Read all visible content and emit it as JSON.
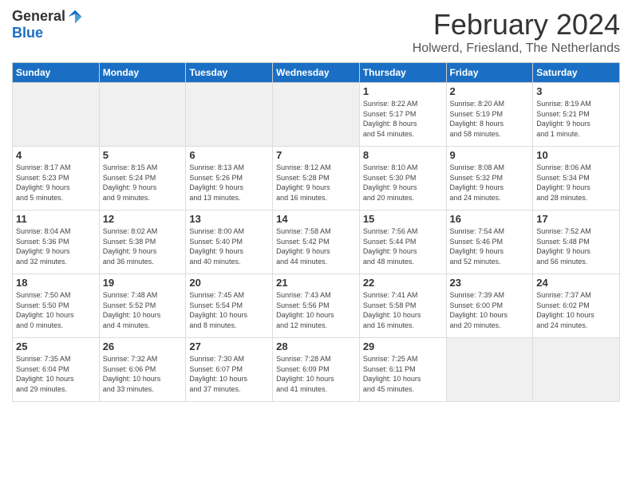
{
  "logo": {
    "general": "General",
    "blue": "Blue"
  },
  "title": "February 2024",
  "location": "Holwerd, Friesland, The Netherlands",
  "days_header": [
    "Sunday",
    "Monday",
    "Tuesday",
    "Wednesday",
    "Thursday",
    "Friday",
    "Saturday"
  ],
  "weeks": [
    [
      {
        "day": "",
        "empty": true
      },
      {
        "day": "",
        "empty": true
      },
      {
        "day": "",
        "empty": true
      },
      {
        "day": "",
        "empty": true
      },
      {
        "day": "1",
        "info": "Sunrise: 8:22 AM\nSunset: 5:17 PM\nDaylight: 8 hours\nand 54 minutes."
      },
      {
        "day": "2",
        "info": "Sunrise: 8:20 AM\nSunset: 5:19 PM\nDaylight: 8 hours\nand 58 minutes."
      },
      {
        "day": "3",
        "info": "Sunrise: 8:19 AM\nSunset: 5:21 PM\nDaylight: 9 hours\nand 1 minute."
      }
    ],
    [
      {
        "day": "4",
        "info": "Sunrise: 8:17 AM\nSunset: 5:23 PM\nDaylight: 9 hours\nand 5 minutes."
      },
      {
        "day": "5",
        "info": "Sunrise: 8:15 AM\nSunset: 5:24 PM\nDaylight: 9 hours\nand 9 minutes."
      },
      {
        "day": "6",
        "info": "Sunrise: 8:13 AM\nSunset: 5:26 PM\nDaylight: 9 hours\nand 13 minutes."
      },
      {
        "day": "7",
        "info": "Sunrise: 8:12 AM\nSunset: 5:28 PM\nDaylight: 9 hours\nand 16 minutes."
      },
      {
        "day": "8",
        "info": "Sunrise: 8:10 AM\nSunset: 5:30 PM\nDaylight: 9 hours\nand 20 minutes."
      },
      {
        "day": "9",
        "info": "Sunrise: 8:08 AM\nSunset: 5:32 PM\nDaylight: 9 hours\nand 24 minutes."
      },
      {
        "day": "10",
        "info": "Sunrise: 8:06 AM\nSunset: 5:34 PM\nDaylight: 9 hours\nand 28 minutes."
      }
    ],
    [
      {
        "day": "11",
        "info": "Sunrise: 8:04 AM\nSunset: 5:36 PM\nDaylight: 9 hours\nand 32 minutes."
      },
      {
        "day": "12",
        "info": "Sunrise: 8:02 AM\nSunset: 5:38 PM\nDaylight: 9 hours\nand 36 minutes."
      },
      {
        "day": "13",
        "info": "Sunrise: 8:00 AM\nSunset: 5:40 PM\nDaylight: 9 hours\nand 40 minutes."
      },
      {
        "day": "14",
        "info": "Sunrise: 7:58 AM\nSunset: 5:42 PM\nDaylight: 9 hours\nand 44 minutes."
      },
      {
        "day": "15",
        "info": "Sunrise: 7:56 AM\nSunset: 5:44 PM\nDaylight: 9 hours\nand 48 minutes."
      },
      {
        "day": "16",
        "info": "Sunrise: 7:54 AM\nSunset: 5:46 PM\nDaylight: 9 hours\nand 52 minutes."
      },
      {
        "day": "17",
        "info": "Sunrise: 7:52 AM\nSunset: 5:48 PM\nDaylight: 9 hours\nand 56 minutes."
      }
    ],
    [
      {
        "day": "18",
        "info": "Sunrise: 7:50 AM\nSunset: 5:50 PM\nDaylight: 10 hours\nand 0 minutes."
      },
      {
        "day": "19",
        "info": "Sunrise: 7:48 AM\nSunset: 5:52 PM\nDaylight: 10 hours\nand 4 minutes."
      },
      {
        "day": "20",
        "info": "Sunrise: 7:45 AM\nSunset: 5:54 PM\nDaylight: 10 hours\nand 8 minutes."
      },
      {
        "day": "21",
        "info": "Sunrise: 7:43 AM\nSunset: 5:56 PM\nDaylight: 10 hours\nand 12 minutes."
      },
      {
        "day": "22",
        "info": "Sunrise: 7:41 AM\nSunset: 5:58 PM\nDaylight: 10 hours\nand 16 minutes."
      },
      {
        "day": "23",
        "info": "Sunrise: 7:39 AM\nSunset: 6:00 PM\nDaylight: 10 hours\nand 20 minutes."
      },
      {
        "day": "24",
        "info": "Sunrise: 7:37 AM\nSunset: 6:02 PM\nDaylight: 10 hours\nand 24 minutes."
      }
    ],
    [
      {
        "day": "25",
        "info": "Sunrise: 7:35 AM\nSunset: 6:04 PM\nDaylight: 10 hours\nand 29 minutes."
      },
      {
        "day": "26",
        "info": "Sunrise: 7:32 AM\nSunset: 6:06 PM\nDaylight: 10 hours\nand 33 minutes."
      },
      {
        "day": "27",
        "info": "Sunrise: 7:30 AM\nSunset: 6:07 PM\nDaylight: 10 hours\nand 37 minutes."
      },
      {
        "day": "28",
        "info": "Sunrise: 7:28 AM\nSunset: 6:09 PM\nDaylight: 10 hours\nand 41 minutes."
      },
      {
        "day": "29",
        "info": "Sunrise: 7:25 AM\nSunset: 6:11 PM\nDaylight: 10 hours\nand 45 minutes."
      },
      {
        "day": "",
        "empty": true
      },
      {
        "day": "",
        "empty": true
      }
    ]
  ]
}
